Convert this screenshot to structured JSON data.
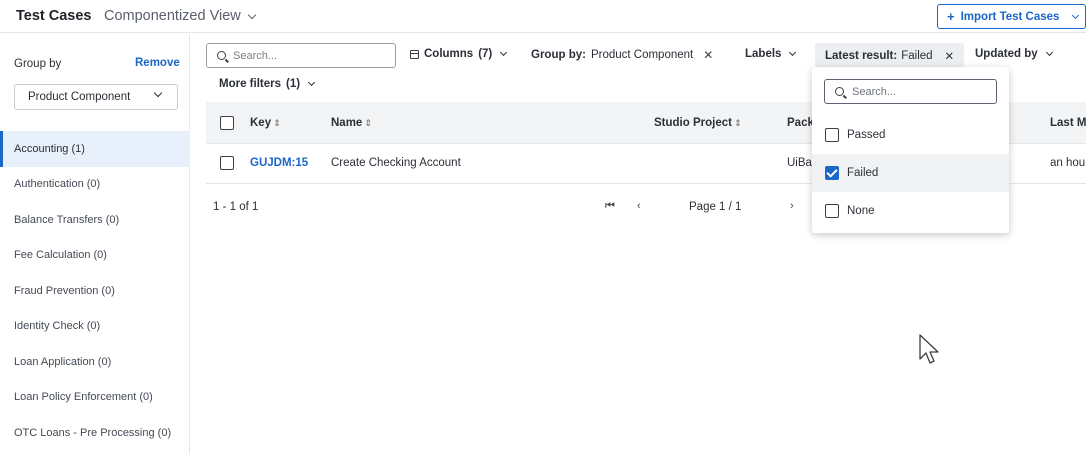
{
  "header": {
    "title": "Test Cases",
    "view_label": "Componentized View",
    "import_button": "Import Test Cases"
  },
  "sidebar": {
    "group_by_label": "Group by",
    "remove_label": "Remove",
    "group_select_value": "Product Component",
    "items": [
      {
        "label": "Accounting (1)",
        "active": true
      },
      {
        "label": "Authentication (0)"
      },
      {
        "label": "Balance Transfers (0)"
      },
      {
        "label": "Fee Calculation (0)"
      },
      {
        "label": "Fraud Prevention (0)"
      },
      {
        "label": "Identity Check (0)"
      },
      {
        "label": "Loan Application (0)"
      },
      {
        "label": "Loan Policy Enforcement (0)"
      },
      {
        "label": "OTC Loans - Pre Processing (0)"
      }
    ]
  },
  "toolbar": {
    "search_placeholder": "Search...",
    "columns_label": "Columns",
    "columns_count": "(7)",
    "group_by_label": "Group by:",
    "group_by_value": "Product Component",
    "labels_label": "Labels",
    "latest_result_label": "Latest result:",
    "latest_result_value": "Failed",
    "updated_by_label": "Updated by",
    "more_filters_label": "More filters",
    "more_filters_count": "(1)"
  },
  "table": {
    "columns": [
      "Key",
      "Name",
      "Studio Project",
      "Pack",
      "Last M"
    ],
    "rows": [
      {
        "key": "GUJDM:15",
        "name": "Create Checking Account",
        "package": "UiBa",
        "last_modified": "an hou"
      }
    ]
  },
  "pagination": {
    "range": "1 - 1 of 1",
    "page": "Page 1 / 1"
  },
  "dropdown": {
    "search_placeholder": "Search...",
    "options": [
      {
        "label": "Passed",
        "checked": false
      },
      {
        "label": "Failed",
        "checked": true
      },
      {
        "label": "None",
        "checked": false
      }
    ]
  },
  "colors": {
    "accent": "#1b66c9",
    "active_bg": "#e8f0fb",
    "header_bg": "#f3f4f6"
  }
}
